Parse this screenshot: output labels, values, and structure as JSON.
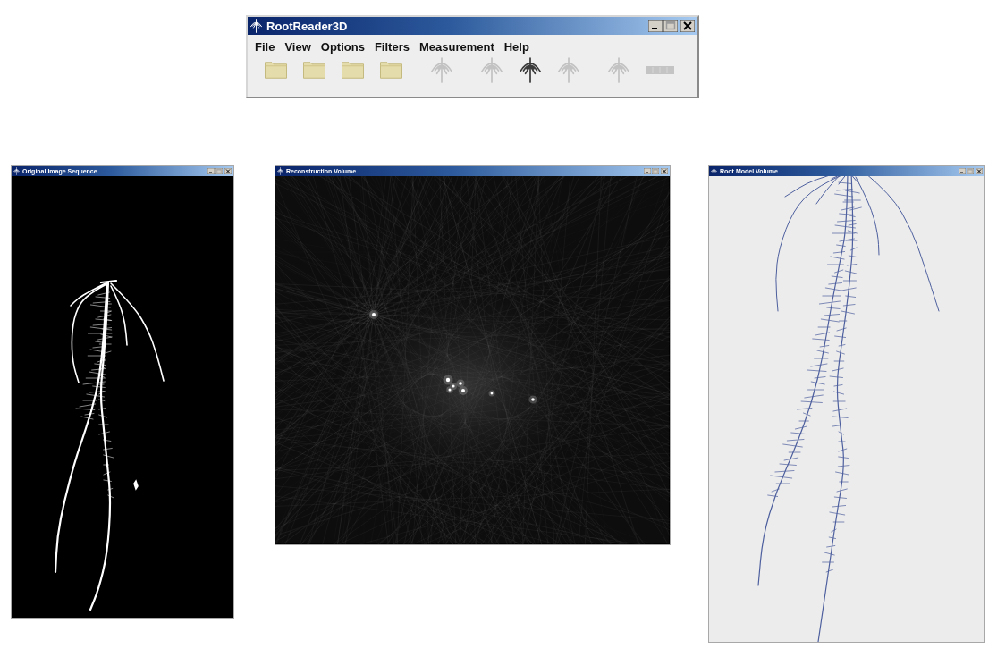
{
  "main_window": {
    "title": "RootReader3D",
    "menu": [
      "File",
      "View",
      "Options",
      "Filters",
      "Measurement",
      "Help"
    ],
    "toolbar": [
      {
        "kind": "folder",
        "disabled": false
      },
      {
        "kind": "folder",
        "disabled": false
      },
      {
        "kind": "folder",
        "disabled": false
      },
      {
        "kind": "folder",
        "disabled": false
      },
      {
        "kind": "root",
        "disabled": true
      },
      {
        "kind": "root",
        "disabled": true
      },
      {
        "kind": "root",
        "disabled": false
      },
      {
        "kind": "root",
        "disabled": true
      },
      {
        "kind": "root",
        "disabled": true
      },
      {
        "kind": "bar",
        "disabled": true
      }
    ]
  },
  "windows": [
    {
      "title": "Original Image Sequence",
      "kind": "image"
    },
    {
      "title": "Reconstruction Volume",
      "kind": "volume"
    },
    {
      "title": "Root Model Volume",
      "kind": "model"
    }
  ]
}
